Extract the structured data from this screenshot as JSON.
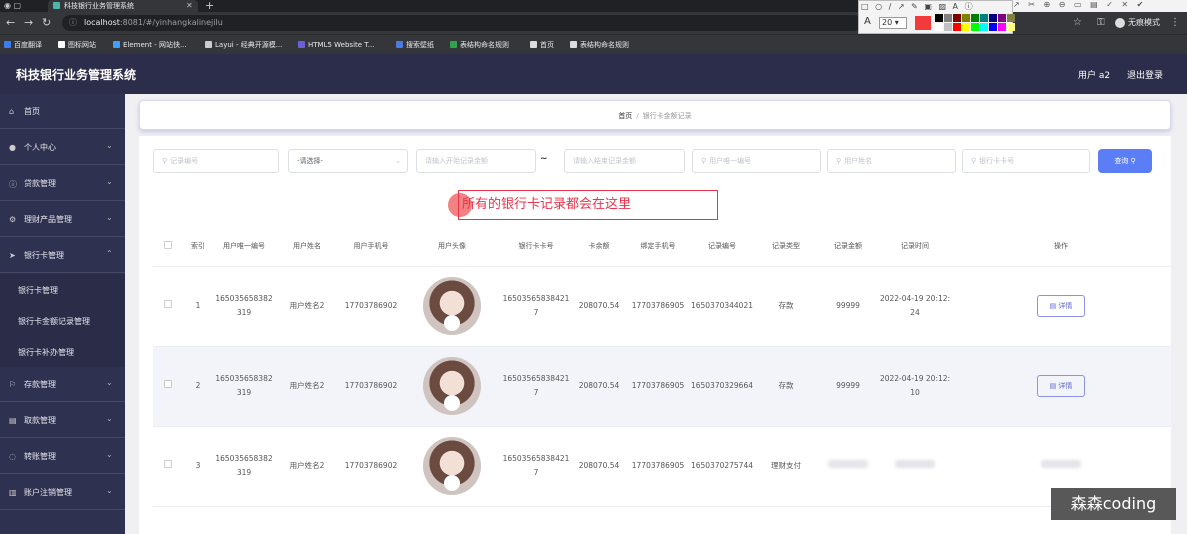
{
  "browser": {
    "tab_title": "科技银行业务管理系统",
    "url_host": "localhost",
    "url_rest": ":8081/#/yinhangkalinejilu",
    "incognito_label": "无痕模式",
    "bookmarks": [
      {
        "label": "百度翻译",
        "color": "#3b7df0"
      },
      {
        "label": "图标网站",
        "color": "#ffffff"
      },
      {
        "label": "Element - 网站快...",
        "color": "#409eff"
      },
      {
        "label": "Layui - 经典开源模...",
        "color": "#cccccc"
      },
      {
        "label": "HTML5 Website T...",
        "color": "#6b5fd8"
      },
      {
        "label": "搜索壁纸",
        "color": "#4a7be0"
      },
      {
        "label": "表结构命名规则",
        "color": "#2ea44f"
      },
      {
        "label": "首页",
        "color": "#dddddd"
      },
      {
        "label": "表结构命名规则",
        "color": "#dddddd"
      }
    ]
  },
  "annotation_toolbar": {
    "font_letter": "A",
    "font_size": "20",
    "current_color": "#f23a3a",
    "palette": [
      "#000000",
      "#808080",
      "#800000",
      "#808000",
      "#008000",
      "#008080",
      "#000080",
      "#800080",
      "#808040",
      "#ffffff",
      "#c0c0c0",
      "#ff0000",
      "#ffff00",
      "#00ff00",
      "#00ffff",
      "#0000ff",
      "#ff00ff",
      "#ffff80"
    ]
  },
  "header": {
    "title": "科技银行业务管理系统",
    "user": "用户 a2",
    "logout": "退出登录"
  },
  "sidebar": {
    "items": [
      {
        "label": "首页",
        "icon": "home-icon",
        "has_chevron": false
      },
      {
        "label": "个人中心",
        "icon": "user-icon",
        "has_chevron": true
      },
      {
        "label": "贷款管理",
        "icon": "info-icon",
        "has_chevron": true
      },
      {
        "label": "理财产品管理",
        "icon": "settings-icon",
        "has_chevron": true
      },
      {
        "label": "银行卡管理",
        "icon": "send-icon",
        "has_chevron": true,
        "expanded": true
      }
    ],
    "sub_items": [
      "银行卡管理",
      "银行卡金额记录管理",
      "银行卡补办管理"
    ],
    "items_after": [
      {
        "label": "存款管理",
        "icon": "deposit-icon"
      },
      {
        "label": "取款管理",
        "icon": "withdraw-icon"
      },
      {
        "label": "转账管理",
        "icon": "transfer-icon"
      },
      {
        "label": "账户注销管理",
        "icon": "account-icon"
      }
    ]
  },
  "breadcrumb": {
    "home": "首页",
    "sep": "/",
    "current": "银行卡金额记录"
  },
  "filters": {
    "record_no": "记录编号",
    "select_default": "-请选择-",
    "start_amount": "请输入开始记录金额",
    "tilde": "~",
    "end_amount": "请输入结束记录金额",
    "user_id": "用户唯一编号",
    "user_name": "用户姓名",
    "card_no": "银行卡卡号",
    "search_btn": "查询"
  },
  "tip_text": "所有的银行卡记录都会在这里",
  "table": {
    "headers": [
      "",
      "索引",
      "用户唯一编号",
      "用户姓名",
      "用户手机号",
      "用户头像",
      "银行卡卡号",
      "卡余额",
      "绑定手机号",
      "记录编号",
      "记录类型",
      "记录金额",
      "记录时间",
      "操作"
    ],
    "detail_label": "详情",
    "rows": [
      {
        "index": "1",
        "user_id": "165035658382319",
        "name": "用户姓名2",
        "phone": "17703786902",
        "card": "165035658384217",
        "balance": "208070.54",
        "bind_phone": "17703786905",
        "record_no": "1650370344021",
        "type": "存款",
        "amount": "99999",
        "time": "2022-04-19 20:12:24"
      },
      {
        "index": "2",
        "user_id": "165035658382319",
        "name": "用户姓名2",
        "phone": "17703786902",
        "card": "165035658384217",
        "balance": "208070.54",
        "bind_phone": "17703786905",
        "record_no": "1650370329664",
        "type": "存款",
        "amount": "99999",
        "time": "2022-04-19 20:12:10"
      },
      {
        "index": "3",
        "user_id": "165035658382319",
        "name": "用户姓名2",
        "phone": "17703786902",
        "card": "165035658384217",
        "balance": "208070.54",
        "bind_phone": "17703786905",
        "record_no": "1650370275744",
        "type": "理财支付",
        "amount": "",
        "time": ""
      }
    ]
  },
  "watermark": "森森coding"
}
